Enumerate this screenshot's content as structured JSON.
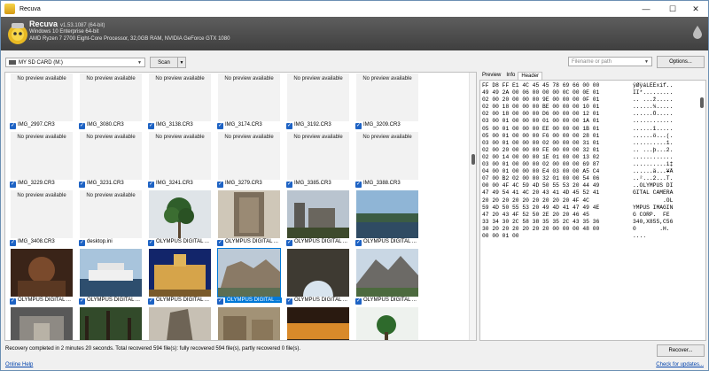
{
  "window": {
    "title": "Recuva",
    "accent": "#0078d7"
  },
  "header": {
    "product": "Recuva",
    "version": "v1.53.1087 (64-bit)",
    "os": "Windows 10 Enterprise 64-bit",
    "hardware": "AMD Ryzen 7 2700 Eight-Core Processor, 32,0GB RAM, NVIDIA GeForce GTX 1080"
  },
  "toolbar": {
    "drive": "MY SD CARD (M:)",
    "scan_label": "Scan",
    "search_placeholder": "Filename or path",
    "options_label": "Options..."
  },
  "files": [
    {
      "name": "IMG_2997.CR3",
      "preview": "none",
      "checked": true
    },
    {
      "name": "IMG_3080.CR3",
      "preview": "none",
      "checked": true
    },
    {
      "name": "IMG_3138.CR3",
      "preview": "none",
      "checked": true
    },
    {
      "name": "IMG_3174.CR3",
      "preview": "none",
      "checked": true
    },
    {
      "name": "IMG_3192.CR3",
      "preview": "none",
      "checked": true
    },
    {
      "name": "IMG_3209.CR3",
      "preview": "none",
      "checked": true
    },
    {
      "name": "IMG_3229.CR3",
      "preview": "none",
      "checked": true
    },
    {
      "name": "IMG_3231.CR3",
      "preview": "none",
      "checked": true
    },
    {
      "name": "IMG_3241.CR3",
      "preview": "none",
      "checked": true
    },
    {
      "name": "IMG_3279.CR3",
      "preview": "none",
      "checked": true
    },
    {
      "name": "IMG_3385.CR3",
      "preview": "none",
      "checked": true
    },
    {
      "name": "IMG_3388.CR3",
      "preview": "none",
      "checked": true
    },
    {
      "name": "IMG_3408.CR3",
      "preview": "none",
      "checked": true
    },
    {
      "name": "desktop.ini",
      "preview": "none",
      "checked": true
    },
    {
      "name": "OLYMPUS DIGITAL ...",
      "preview": "tree",
      "checked": true
    },
    {
      "name": "OLYMPUS DIGITAL ...",
      "preview": "ruin",
      "checked": true
    },
    {
      "name": "OLYMPUS DIGITAL ...",
      "preview": "castle",
      "checked": true
    },
    {
      "name": "OLYMPUS DIGITAL ...",
      "preview": "coast",
      "checked": true
    },
    {
      "name": "OLYMPUS DIGITAL ...",
      "preview": "cellar",
      "checked": true
    },
    {
      "name": "OLYMPUS DIGITAL ...",
      "preview": "ship",
      "checked": true
    },
    {
      "name": "OLYMPUS DIGITAL ...",
      "preview": "palace",
      "checked": true
    },
    {
      "name": "OLYMPUS DIGITAL ...",
      "preview": "cliffs",
      "checked": true,
      "selected": true
    },
    {
      "name": "OLYMPUS DIGITAL ...",
      "preview": "cave",
      "checked": true
    },
    {
      "name": "OLYMPUS DIGITAL ...",
      "preview": "mountain",
      "checked": true
    },
    {
      "name": "OLYMPUS DIGITAL ...",
      "preview": "chapel",
      "checked": true
    },
    {
      "name": "OLYMPUS DIGITAL ...",
      "preview": "forest",
      "checked": true
    },
    {
      "name": "OLYMPUS DIGITAL ...",
      "preview": "rock",
      "checked": true
    },
    {
      "name": "OLYMPUS DIGITAL ...",
      "preview": "stones",
      "checked": true
    },
    {
      "name": "OLYMPUS DIGITAL ...",
      "preview": "sunset",
      "checked": true
    },
    {
      "name": "OLYMPUS DIGITAL ...",
      "preview": "garden",
      "checked": true
    }
  ],
  "no_preview_text": "No preview available",
  "right_tabs": [
    "Preview",
    "Info",
    "Header"
  ],
  "active_tab": "Header",
  "hex_rows": [
    {
      "hex": "FF D8 FF E1 4C 45 45 78 69 66 00 00",
      "ascii": "ÿØÿáLEExif.."
    },
    {
      "hex": "49 49 2A 00 06 00 00 00 0C 00 0E 01",
      "ascii": "II*........."
    },
    {
      "hex": "02 00 20 00 00 00 9E 00 00 00 0F 01",
      "ascii": ".. ...ž....."
    },
    {
      "hex": "02 00 18 00 00 00 BE 00 00 00 10 01",
      "ascii": "......¾....."
    },
    {
      "hex": "02 00 18 00 00 00 D6 00 00 00 12 01",
      "ascii": "......Ö....."
    },
    {
      "hex": "03 00 01 00 00 00 01 00 00 00 1A 01",
      "ascii": "............"
    },
    {
      "hex": "05 00 01 00 00 00 EE 00 00 00 1B 01",
      "ascii": "......î....."
    },
    {
      "hex": "05 00 01 00 00 00 F6 00 00 00 28 01",
      "ascii": "......ö...(."
    },
    {
      "hex": "03 00 01 00 00 00 02 00 00 00 31 01",
      "ascii": "..........1."
    },
    {
      "hex": "02 00 20 00 00 00 FE 00 00 00 32 01",
      "ascii": ".. ...þ...2."
    },
    {
      "hex": "02 00 14 00 00 00 1E 01 00 00 13 02",
      "ascii": "............"
    },
    {
      "hex": "03 00 01 00 00 00 02 00 00 00 69 87",
      "ascii": "..........i‡"
    },
    {
      "hex": "04 00 01 00 00 00 E4 03 00 00 A5 C4",
      "ascii": "......ä...¥Ä"
    },
    {
      "hex": "07 00 B2 02 00 00 32 01 00 00 54 06",
      "ascii": "..²...2...T."
    },
    {
      "hex": "00 00 4F 4C 59 4D 50 55 53 20 44 49",
      "ascii": "..OLYMPUS DI"
    },
    {
      "hex": "47 49 54 41 4C 20 43 41 4D 45 52 41",
      "ascii": "GITAL CAMERA"
    },
    {
      "hex": "20 20 20 20 20 20 20 20 20 4F 4C",
      "ascii": "         .OL"
    },
    {
      "hex": "59 4D 50 55 53 20 49 4D 41 47 49 4E",
      "ascii": "YMPUS IMAGIN"
    },
    {
      "hex": "47 20 43 4F 52 50 2E 20 20 46 45",
      "ascii": "G CORP.  FE"
    },
    {
      "hex": "33 34 30 2C 58 38 35 35 2C 43 35 36",
      "ascii": "340,X855,C56"
    },
    {
      "hex": "30 20 20 20 20 20 20 00 00 00 48 00",
      "ascii": "0       .H."
    },
    {
      "hex": "00 00 01 00",
      "ascii": "...."
    }
  ],
  "status_text": "Recovery completed in 2 minutes 20 seconds. Total recovered 594 file(s): fully recovered 594 file(s), partly recovered 0 file(s).",
  "recover_label": "Recover...",
  "footer": {
    "help": "Online Help",
    "updates": "Check for updates..."
  }
}
